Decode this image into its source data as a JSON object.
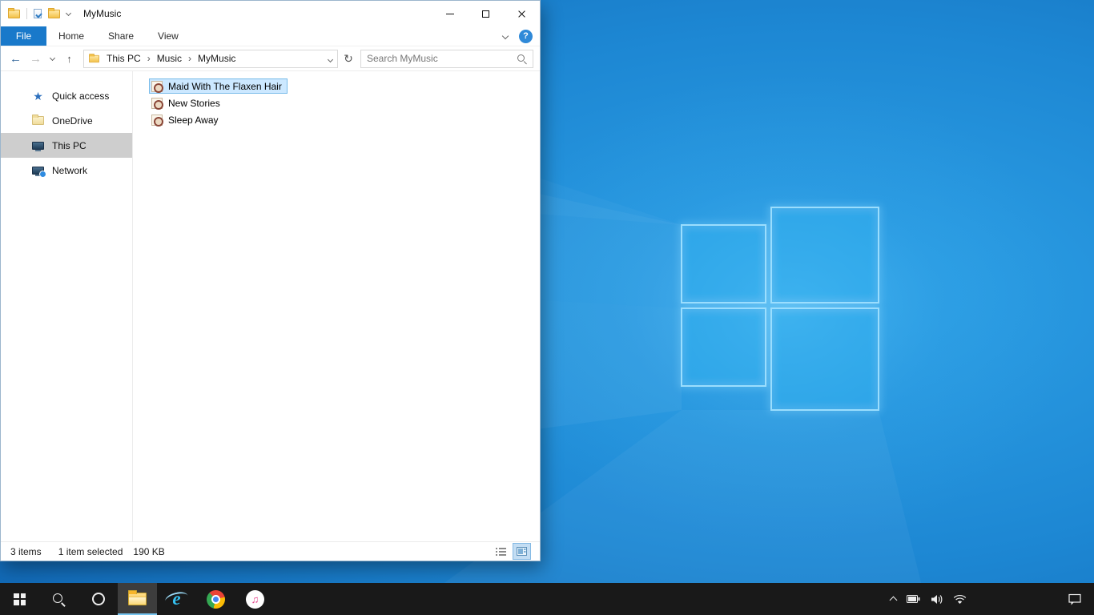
{
  "window": {
    "title": "MyMusic",
    "ribbon": {
      "tabs": [
        "File",
        "Home",
        "Share",
        "View"
      ]
    },
    "nav": {
      "crumbs": [
        "This PC",
        "Music",
        "MyMusic"
      ],
      "search_placeholder": "Search MyMusic"
    },
    "sidebar": {
      "items": [
        "Quick access",
        "OneDrive",
        "This PC",
        "Network"
      ]
    },
    "files": [
      "Maid With The Flaxen Hair",
      "New Stories",
      "Sleep Away"
    ],
    "status": {
      "items": "3 items",
      "selected": "1 item selected",
      "size": "190 KB"
    }
  },
  "icons": {
    "back": "←",
    "forward": "→",
    "up": "↑",
    "refresh": "↻",
    "crumb_sep": "›",
    "help": "?",
    "star": "★",
    "ie": "e",
    "itunes_note": "♫"
  },
  "colors": {
    "file_tab_blue": "#1979ca",
    "selection_blue": "#cce8ff",
    "sidebar_selected_gray": "#cecece",
    "taskbar_dark": "#191919",
    "desktop_blue": "#1d87d3"
  }
}
